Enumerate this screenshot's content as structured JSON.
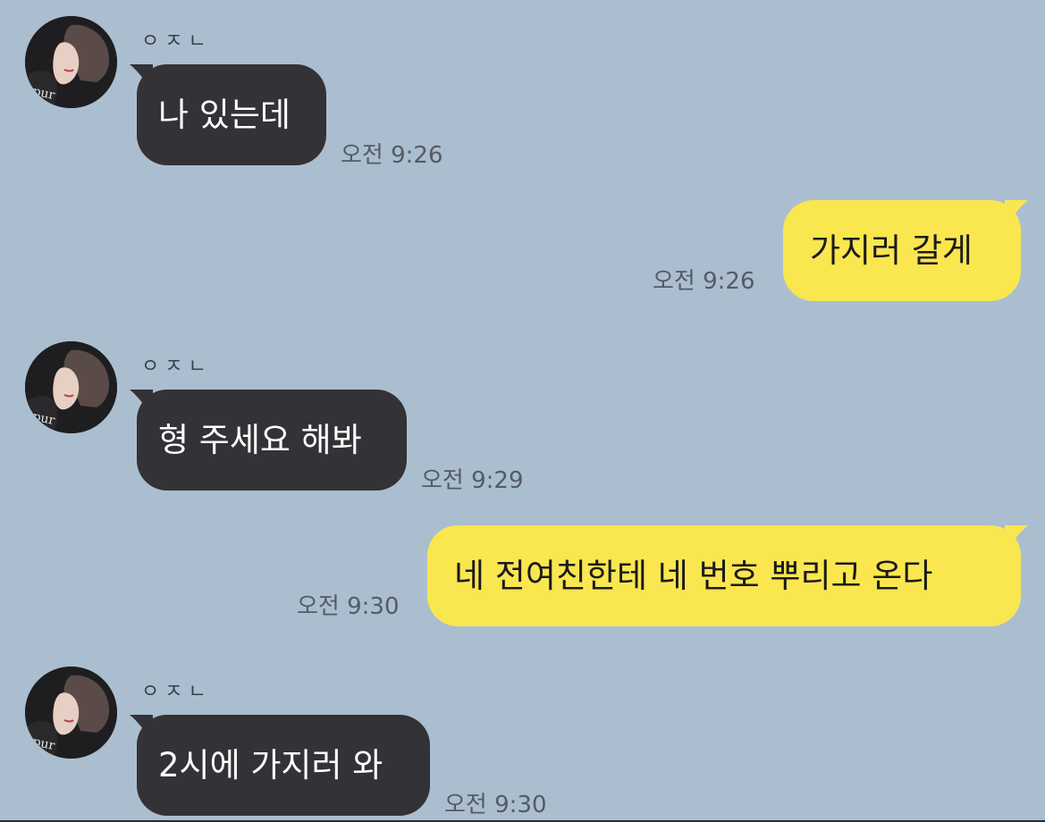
{
  "chat": {
    "background": "#abbed0",
    "incoming_color": "#333236",
    "outgoing_color": "#fae64f",
    "messages": [
      {
        "direction": "in",
        "sender": "ㅇㅈㄴ",
        "text": "나 있는데",
        "time": "오전 9:26",
        "avatar_icon": "profile-photo"
      },
      {
        "direction": "out",
        "text": "가지러 갈게",
        "time": "오전 9:26"
      },
      {
        "direction": "in",
        "sender": "ㅇㅈㄴ",
        "text": "형 주세요 해봐",
        "time": "오전 9:29",
        "avatar_icon": "profile-photo"
      },
      {
        "direction": "out",
        "text": "네 전여친한테 네 번호 뿌리고 온다",
        "time": "오전 9:30"
      },
      {
        "direction": "in",
        "sender": "ㅇㅈㄴ",
        "text": "2시에 가지러 와",
        "time": "오전 9:30",
        "avatar_icon": "profile-photo"
      }
    ]
  }
}
